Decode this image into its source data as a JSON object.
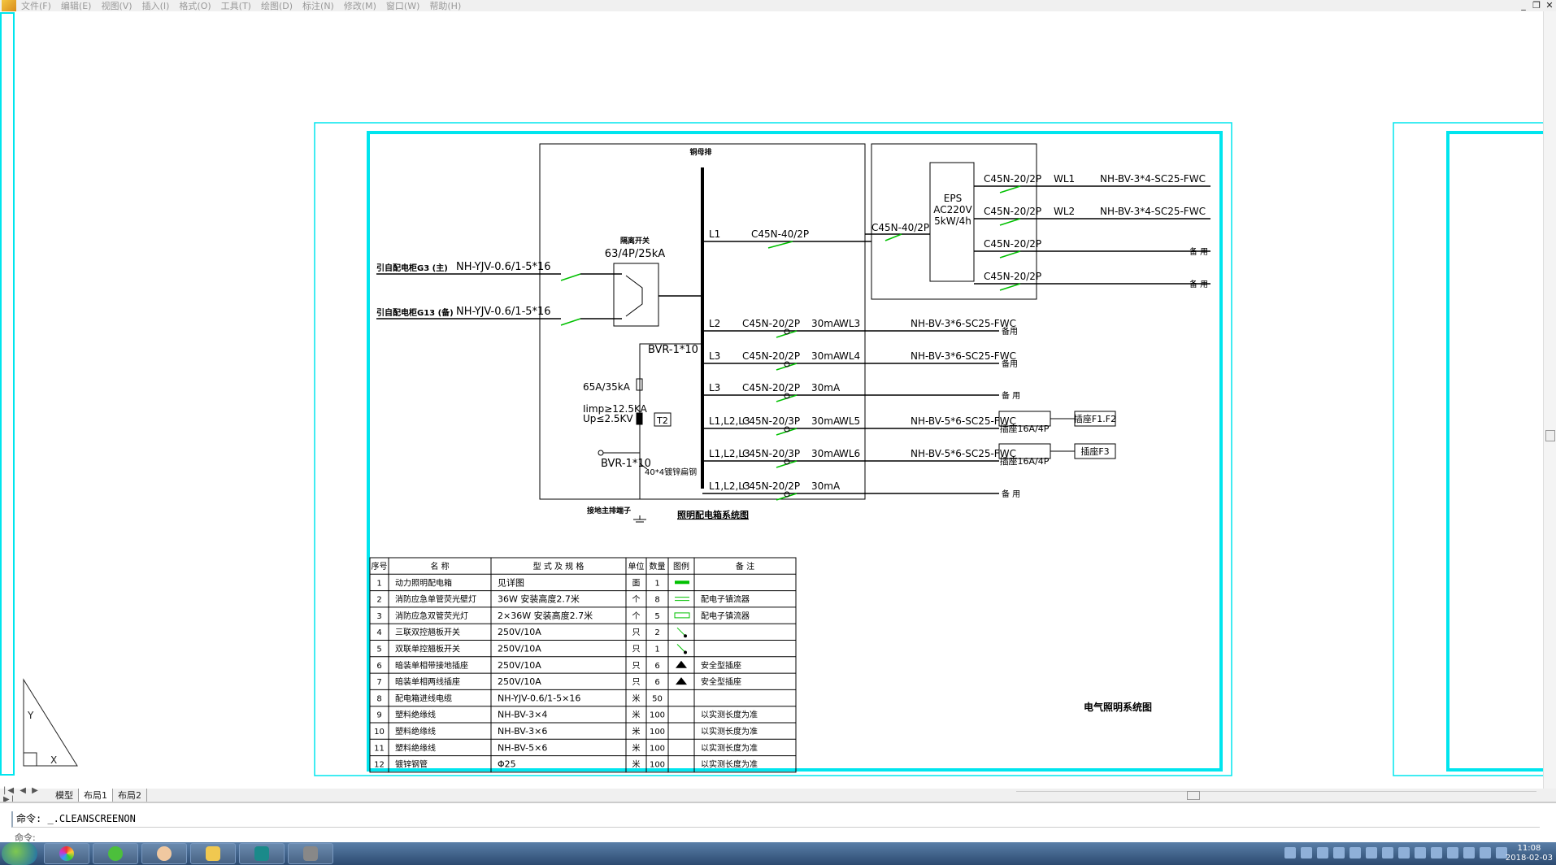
{
  "menubar": {
    "items": [
      "文件(F)",
      "编辑(E)",
      "视图(V)",
      "插入(I)",
      "格式(O)",
      "工具(T)",
      "绘图(D)",
      "标注(N)",
      "修改(M)",
      "窗口(W)",
      "帮助(H)"
    ]
  },
  "drawing": {
    "panel": {
      "busbar_label": "铜母排",
      "breaker_label": "隔离开关",
      "breaker_spec": "63/4P/25kA",
      "incoming": [
        {
          "source": "引自配电柜G3 (主)",
          "cable": "NH-YJV-0.6/1-5*16"
        },
        {
          "source": "引自配电柜G13 (备)",
          "cable": "NH-YJV-0.6/1-5*16"
        }
      ],
      "spd": {
        "wire1": "BVR-1*10",
        "fuse": "65A/35kA",
        "imp": "Iimp≥12.5KA",
        "up": "Up≤2.5KV",
        "type": "T2",
        "wire2": "BVR-1*10",
        "flat": "40*4镀锌扁钢",
        "ground": "接地主排端子"
      },
      "circuits": [
        {
          "phase": "L1",
          "breaker": "C45N-40/2P",
          "rcd": "",
          "wl": "",
          "cable": "",
          "dest": ""
        },
        {
          "phase": "L2",
          "breaker": "C45N-20/2P",
          "rcd": "30mA",
          "wl": "WL3",
          "cable": "NH-BV-3*6-SC25-FWC",
          "dest": "备用"
        },
        {
          "phase": "L3",
          "breaker": "C45N-20/2P",
          "rcd": "30mA",
          "wl": "WL4",
          "cable": "NH-BV-3*6-SC25-FWC",
          "dest": "备用"
        },
        {
          "phase": "L3",
          "breaker": "C45N-20/2P",
          "rcd": "30mA",
          "wl": "",
          "cable": "",
          "dest": "备 用"
        },
        {
          "phase": "L1,L2,L3",
          "breaker": "C45N-20/3P",
          "rcd": "30mA",
          "wl": "WL5",
          "cable": "NH-BV-5*6-SC25-FWC",
          "dest": "插座16A/4P"
        },
        {
          "phase": "L1,L2,L3",
          "breaker": "C45N-20/3P",
          "rcd": "30mA",
          "wl": "WL6",
          "cable": "NH-BV-5*6-SC25-FWC",
          "dest": "插座16A/4P"
        },
        {
          "phase": "L1,L2,L3",
          "breaker": "C45N-20/2P",
          "rcd": "30mA",
          "wl": "",
          "cable": "",
          "dest": "备 用"
        }
      ],
      "prefix_N": "N",
      "dest_boxes": [
        "插座F1.F2",
        "插座F3"
      ],
      "title": "照明配电箱系统图"
    },
    "eps": {
      "input_breaker": "C45N-40/2P",
      "label": [
        "EPS",
        "AC220V",
        "5kW/4h"
      ],
      "outputs": [
        {
          "breaker": "C45N-20/2P",
          "wl": "WL1",
          "cable": "NH-BV-3*4-SC25-FWC",
          "dest": ""
        },
        {
          "breaker": "C45N-20/2P",
          "wl": "WL2",
          "cable": "NH-BV-3*4-SC25-FWC",
          "dest": ""
        },
        {
          "breaker": "C45N-20/2P",
          "wl": "",
          "cable": "",
          "dest": "备 用"
        },
        {
          "breaker": "C45N-20/2P",
          "wl": "",
          "cable": "",
          "dest": "备 用"
        }
      ]
    },
    "table": {
      "headers": [
        "序号",
        "名 称",
        "型 式 及 规 格",
        "单位",
        "数量",
        "图例",
        "备 注"
      ],
      "rows": [
        [
          "1",
          "动力照明配电箱",
          "见详图",
          "面",
          "1",
          "",
          ""
        ],
        [
          "2",
          "消防应急单管荧光壁灯",
          "36W 安装高度2.7米",
          "个",
          "8",
          "",
          "配电子镇流器"
        ],
        [
          "3",
          "消防应急双管荧光灯",
          "2×36W 安装高度2.7米",
          "个",
          "5",
          "",
          "配电子镇流器"
        ],
        [
          "4",
          "三联双控翘板开关",
          "250V/10A",
          "只",
          "2",
          "",
          ""
        ],
        [
          "5",
          "双联单控翘板开关",
          "250V/10A",
          "只",
          "1",
          "",
          ""
        ],
        [
          "6",
          "暗装单相带接地插座",
          "250V/10A",
          "只",
          "6",
          "",
          "安全型插座"
        ],
        [
          "7",
          "暗装单相两线插座",
          "250V/10A",
          "只",
          "6",
          "",
          "安全型插座"
        ],
        [
          "8",
          "配电箱进线电缆",
          "NH-YJV-0.6/1-5×16",
          "米",
          "50",
          "",
          ""
        ],
        [
          "9",
          "塑料绝缘线",
          "NH-BV-3×4",
          "米",
          "100",
          "",
          "以实测长度为准"
        ],
        [
          "10",
          "塑料绝缘线",
          "NH-BV-3×6",
          "米",
          "100",
          "",
          "以实测长度为准"
        ],
        [
          "11",
          "塑料绝缘线",
          "NH-BV-5×6",
          "米",
          "100",
          "",
          "以实测长度为准"
        ],
        [
          "12",
          "镀锌钢管",
          "Φ25",
          "米",
          "100",
          "",
          "以实测长度为准"
        ]
      ]
    },
    "sheet_title": "电气照明系统图"
  },
  "tabs": {
    "items": [
      "模型",
      "布局1",
      "布局2"
    ],
    "active": 1
  },
  "command": {
    "prompt": "命令: _.CLEANSCREENON",
    "line2": "命令:"
  },
  "taskbar": {
    "time": "11:08",
    "date": "2018-02-03"
  },
  "colors": {
    "frame": "#00e5ee",
    "breaker_green": "#00c000",
    "line": "#000000"
  }
}
